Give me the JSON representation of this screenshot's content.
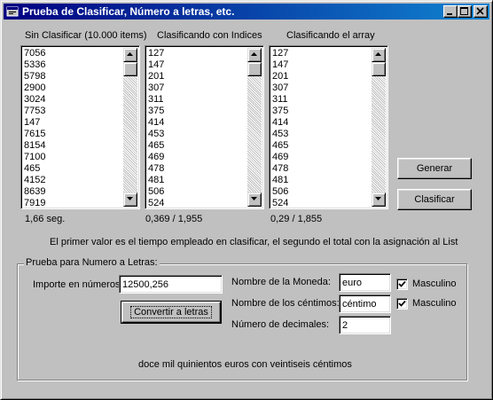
{
  "window": {
    "title": "Prueba de Clasificar, Número a letras, etc."
  },
  "lists": [
    {
      "header": "Sin Clasificar (10.000 items)",
      "items": [
        "7056",
        "5336",
        "5798",
        "2900",
        "3024",
        "7753",
        "147",
        "7615",
        "8154",
        "7100",
        "465",
        "4152",
        "8639",
        "7919"
      ],
      "time": "1,66 seg."
    },
    {
      "header": "Clasificando con Indices",
      "items": [
        "127",
        "147",
        "201",
        "307",
        "311",
        "375",
        "414",
        "453",
        "465",
        "469",
        "478",
        "481",
        "506",
        "524"
      ],
      "time": "0,369 / 1,955"
    },
    {
      "header": "Clasificando el array",
      "items": [
        "127",
        "147",
        "201",
        "307",
        "311",
        "375",
        "414",
        "453",
        "465",
        "469",
        "478",
        "481",
        "506",
        "524"
      ],
      "time": "0,29 / 1,855"
    }
  ],
  "buttons": {
    "generar": "Generar",
    "clasificar": "Clasificar",
    "convertir": "Convertir a letras"
  },
  "info_text": "El primer valor es el tiempo empleado en clasificar, el segundo el total con la asignación al List",
  "numero_letras": {
    "group_title": "Prueba para Numero a Letras:",
    "importe_label": "Importe en números:",
    "importe_value": "12500,256",
    "moneda_label": "Nombre de la Moneda:",
    "moneda_value": "euro",
    "moneda_masculino_label": "Masculino",
    "moneda_masculino_checked": true,
    "centimos_label": "Nombre de los céntimos:",
    "centimos_value": "céntimo",
    "centimos_masculino_label": "Masculino",
    "centimos_masculino_checked": true,
    "decimales_label": "Número de decimales:",
    "decimales_value": "2",
    "result_text": "doce mil quinientos euros con veintiseis céntimos"
  }
}
